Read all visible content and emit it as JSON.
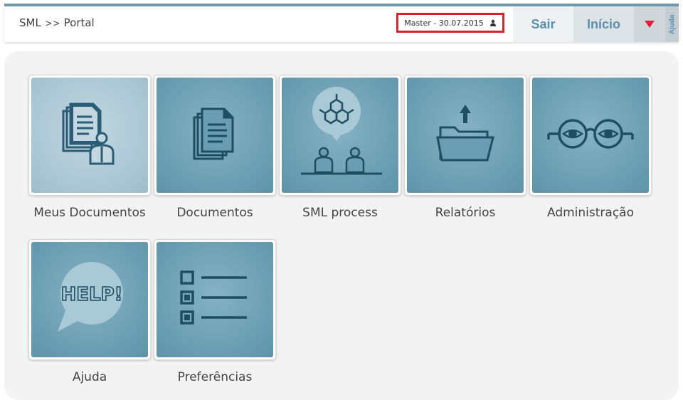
{
  "header": {
    "breadcrumb": {
      "root": "SML",
      "separator": ">>",
      "current": "Portal"
    },
    "user_info": "Master - 30.07.2015",
    "buttons": {
      "sair": "Sair",
      "inicio": "Início",
      "ajuda": "Ajuda"
    }
  },
  "tiles": [
    {
      "label": "Meus Documentos",
      "icon": "my-documents-icon"
    },
    {
      "label": "Documentos",
      "icon": "documents-icon"
    },
    {
      "label": "SML process",
      "icon": "sml-process-icon"
    },
    {
      "label": "Relatórios",
      "icon": "reports-folder-icon"
    },
    {
      "label": "Administração",
      "icon": "glasses-eyes-icon"
    },
    {
      "label": "Ajuda",
      "icon": "help-bubble-icon"
    },
    {
      "label": "Preferências",
      "icon": "checklist-icon"
    }
  ],
  "colors": {
    "accent": "#5a8fae",
    "tile": "#6a9db1",
    "highlight_border": "#d9222a",
    "menu_arrow": "#e0203a"
  }
}
